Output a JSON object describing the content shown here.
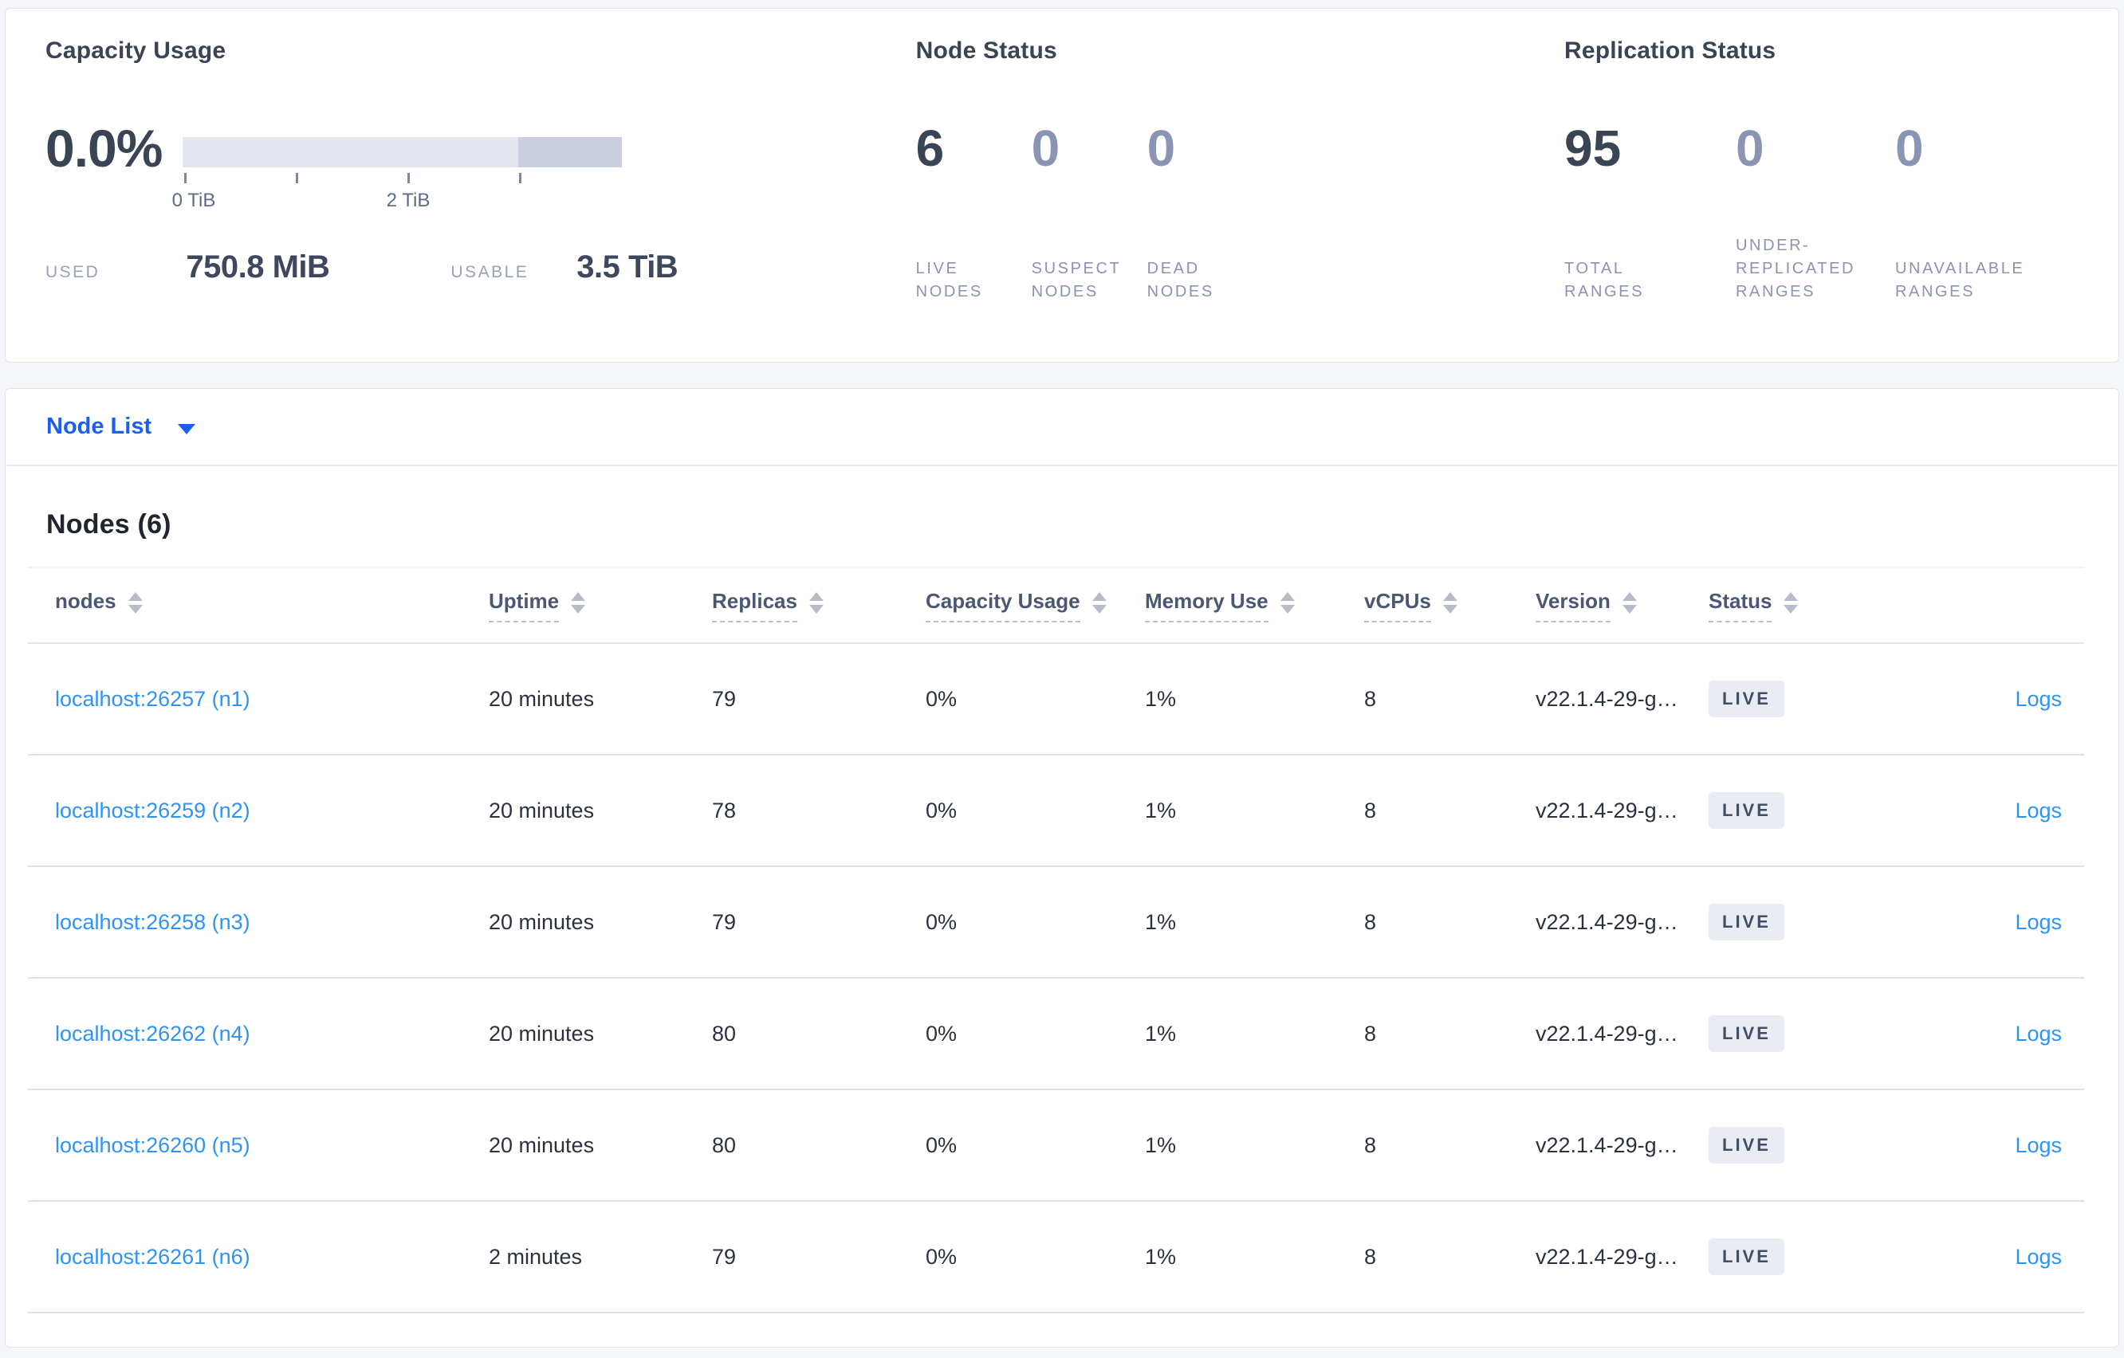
{
  "panels": {
    "capacity": {
      "title": "Capacity Usage",
      "percent": "0.0%",
      "bar": {
        "scale_ticks_tib": [
          0,
          1,
          2,
          3
        ],
        "start_label": "0 TiB",
        "mid_label": "2 TiB",
        "light_color": "#e4e6ef",
        "dark_color": "#cacfdf"
      },
      "used_label": "USED",
      "used_value": "750.8 MiB",
      "usable_label": "USABLE",
      "usable_value": "3.5 TiB"
    },
    "node_status": {
      "title": "Node Status",
      "stats": [
        {
          "value": "6",
          "label": "LIVE NODES"
        },
        {
          "value": "0",
          "label": "SUSPECT NODES"
        },
        {
          "value": "0",
          "label": "DEAD NODES"
        }
      ]
    },
    "replication": {
      "title": "Replication Status",
      "stats": [
        {
          "value": "95",
          "label": "TOTAL RANGES"
        },
        {
          "value": "0",
          "label": "UNDER-REPLICATED RANGES"
        },
        {
          "value": "0",
          "label": "UNAVAILABLE RANGES"
        }
      ]
    }
  },
  "node_list": {
    "dropdown_label": "Node List",
    "heading": "Nodes (6)",
    "columns": [
      "nodes",
      "Uptime",
      "Replicas",
      "Capacity Usage",
      "Memory Use",
      "vCPUs",
      "Version",
      "Status"
    ],
    "rows": [
      {
        "node": "localhost:26257 (n1)",
        "uptime": "20 minutes",
        "replicas": "79",
        "capacity": "0%",
        "memory": "1%",
        "vcpus": "8",
        "version": "v22.1.4-29-g…",
        "status": "LIVE",
        "logs": "Logs"
      },
      {
        "node": "localhost:26259 (n2)",
        "uptime": "20 minutes",
        "replicas": "78",
        "capacity": "0%",
        "memory": "1%",
        "vcpus": "8",
        "version": "v22.1.4-29-g…",
        "status": "LIVE",
        "logs": "Logs"
      },
      {
        "node": "localhost:26258 (n3)",
        "uptime": "20 minutes",
        "replicas": "79",
        "capacity": "0%",
        "memory": "1%",
        "vcpus": "8",
        "version": "v22.1.4-29-g…",
        "status": "LIVE",
        "logs": "Logs"
      },
      {
        "node": "localhost:26262 (n4)",
        "uptime": "20 minutes",
        "replicas": "80",
        "capacity": "0%",
        "memory": "1%",
        "vcpus": "8",
        "version": "v22.1.4-29-g…",
        "status": "LIVE",
        "logs": "Logs"
      },
      {
        "node": "localhost:26260 (n5)",
        "uptime": "20 minutes",
        "replicas": "80",
        "capacity": "0%",
        "memory": "1%",
        "vcpus": "8",
        "version": "v22.1.4-29-g…",
        "status": "LIVE",
        "logs": "Logs"
      },
      {
        "node": "localhost:26261 (n6)",
        "uptime": "2 minutes",
        "replicas": "79",
        "capacity": "0%",
        "memory": "1%",
        "vcpus": "8",
        "version": "v22.1.4-29-g…",
        "status": "LIVE",
        "logs": "Logs"
      }
    ]
  },
  "icons": {
    "dropdown_caret": "caret-down-icon",
    "column_sort": "sort-arrows-icon"
  },
  "colors": {
    "page_background": "#f4f6fa",
    "panel_border": "#e1e4ec",
    "title_text": "#394455",
    "muted_stat_number": "#8a94b3",
    "stat_label": "#8a94b0",
    "primary_link": "#1b5ff0",
    "table_link": "#3093f2",
    "badge_background": "#e9ecf3",
    "badge_text": "#404e66",
    "row_divider": "#dde1ee"
  }
}
